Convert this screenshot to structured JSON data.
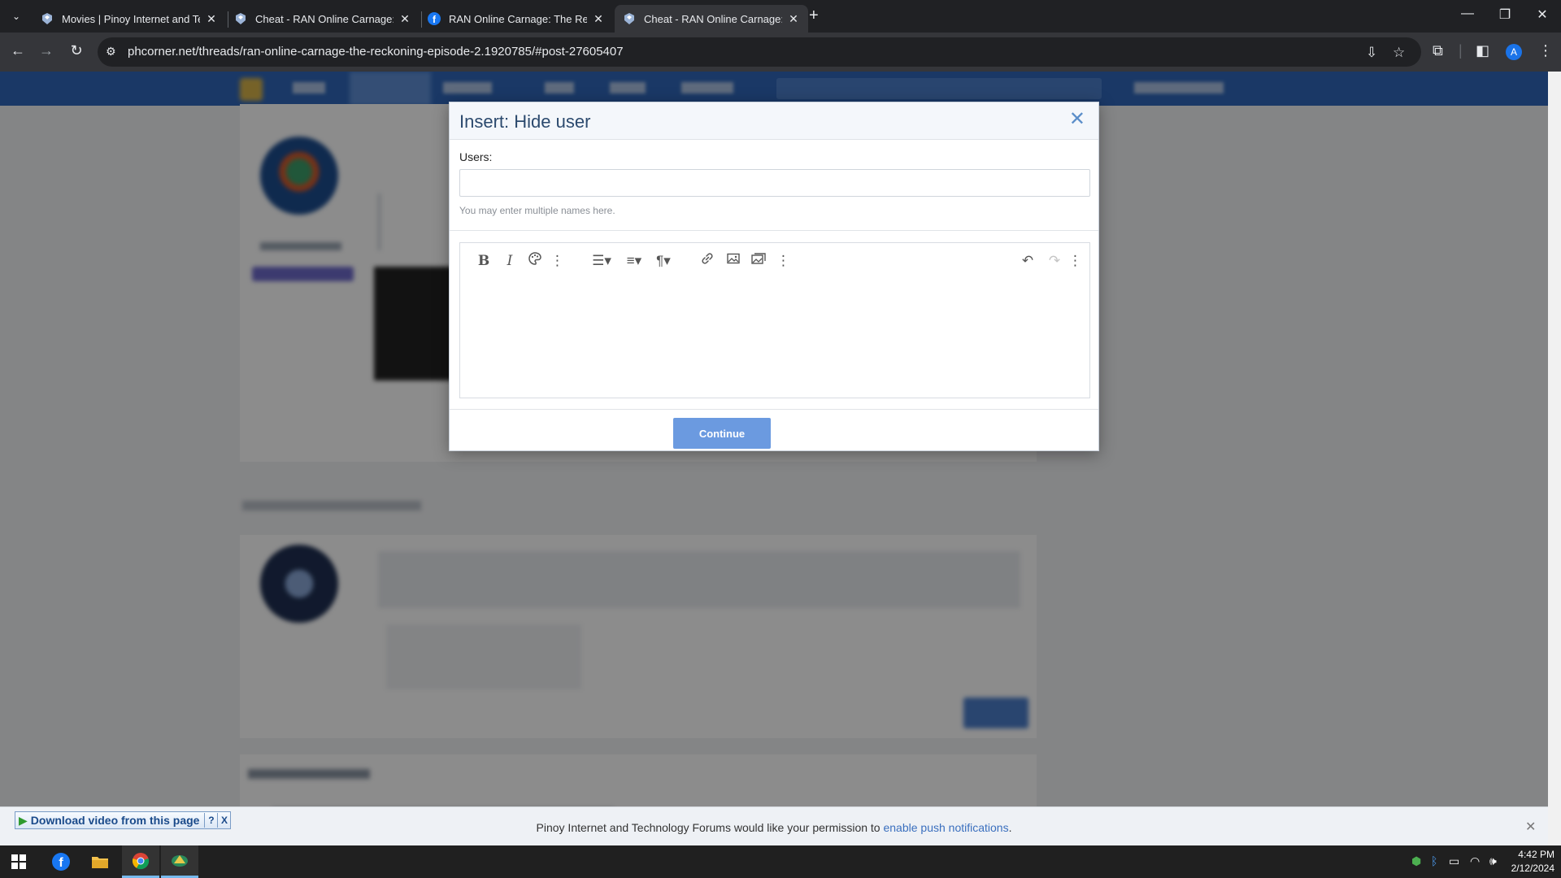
{
  "browser": {
    "tabs": [
      {
        "title": "Movies | Pinoy Internet and Tec",
        "active": false
      },
      {
        "title": "Cheat - RAN Online Carnage: Th",
        "active": false
      },
      {
        "title": "RAN Online Carnage: The Reck",
        "active": false
      },
      {
        "title": "Cheat - RAN Online Carnage: Th",
        "active": true
      }
    ],
    "new_tab": "+",
    "url": "phcorner.net/threads/ran-online-carnage-the-reckoning-episode-2.1920785/#post-27605407",
    "profile_initial": "A"
  },
  "modal": {
    "title": "Insert: Hide user",
    "users_label": "Users:",
    "users_value": "",
    "users_hint": "You may enter multiple names here.",
    "continue_label": "Continue"
  },
  "notification": {
    "text": "Pinoy Internet and Technology Forums would like your permission to ",
    "link": "enable push notifications",
    "suffix": "."
  },
  "download_bar": {
    "label": "Download video from this page",
    "help": "?",
    "close": "X"
  },
  "taskbar": {
    "time": "4:42 PM",
    "date": "2/12/2024"
  },
  "colors": {
    "site_nav": "#3067ba",
    "modal_title": "#2c4a6e",
    "continue_button": "#6b9ae0",
    "link": "#3a6fbe"
  }
}
